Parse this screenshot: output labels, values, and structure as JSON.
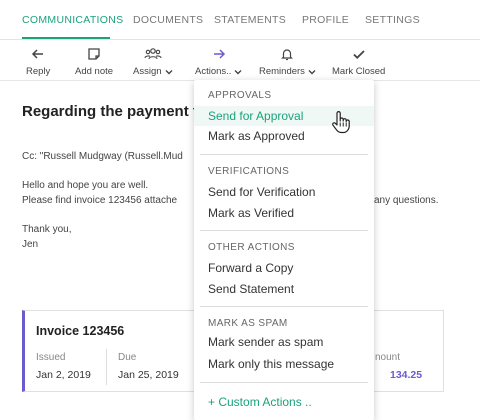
{
  "tabs": [
    {
      "label": "COMMUNICATIONS",
      "active": true
    },
    {
      "label": "DOCUMENTS"
    },
    {
      "label": "STATEMENTS"
    },
    {
      "label": "PROFILE"
    },
    {
      "label": "SETTINGS"
    }
  ],
  "toolbar": {
    "reply": "Reply",
    "add_note": "Add note",
    "assign": "Assign",
    "actions": "Actions..",
    "reminders": "Reminders",
    "mark_closed": "Mark Closed"
  },
  "email": {
    "subject": "Regarding the payment  fo",
    "cc": "Cc: \"Russell Mudgway (Russell.Mud",
    "greeting": "Hello and hope you are well.",
    "line": "Please find  invoice 123456 attache",
    "line_tail": "any questions.",
    "thanks": "Thank you,",
    "signature": "Jen"
  },
  "invoice": {
    "title": "Invoice 123456",
    "issued_label": "Issued",
    "issued_value": "Jan 2, 2019",
    "due_label": "Due",
    "due_value": "Jan 25, 2019",
    "amount_label": "nount",
    "amount_value": "134.25"
  },
  "dropdown": {
    "sections": [
      {
        "title": "APPROVALS",
        "items": [
          "Send for Approval",
          "Mark as Approved"
        ]
      },
      {
        "title": "VERIFICATIONS",
        "items": [
          "Send for Verification",
          "Mark as Verified"
        ]
      },
      {
        "title": "OTHER ACTIONS",
        "items": [
          "Forward a Copy",
          "Send Statement"
        ]
      },
      {
        "title": "MARK AS SPAM",
        "items": [
          "Mark sender as spam",
          "Mark only this message"
        ]
      }
    ],
    "custom": "+ Custom Actions .."
  },
  "colors": {
    "accent": "#1aa37a",
    "invoice_accent": "#6a5ccf",
    "action_icon": "#6a5ccf"
  }
}
